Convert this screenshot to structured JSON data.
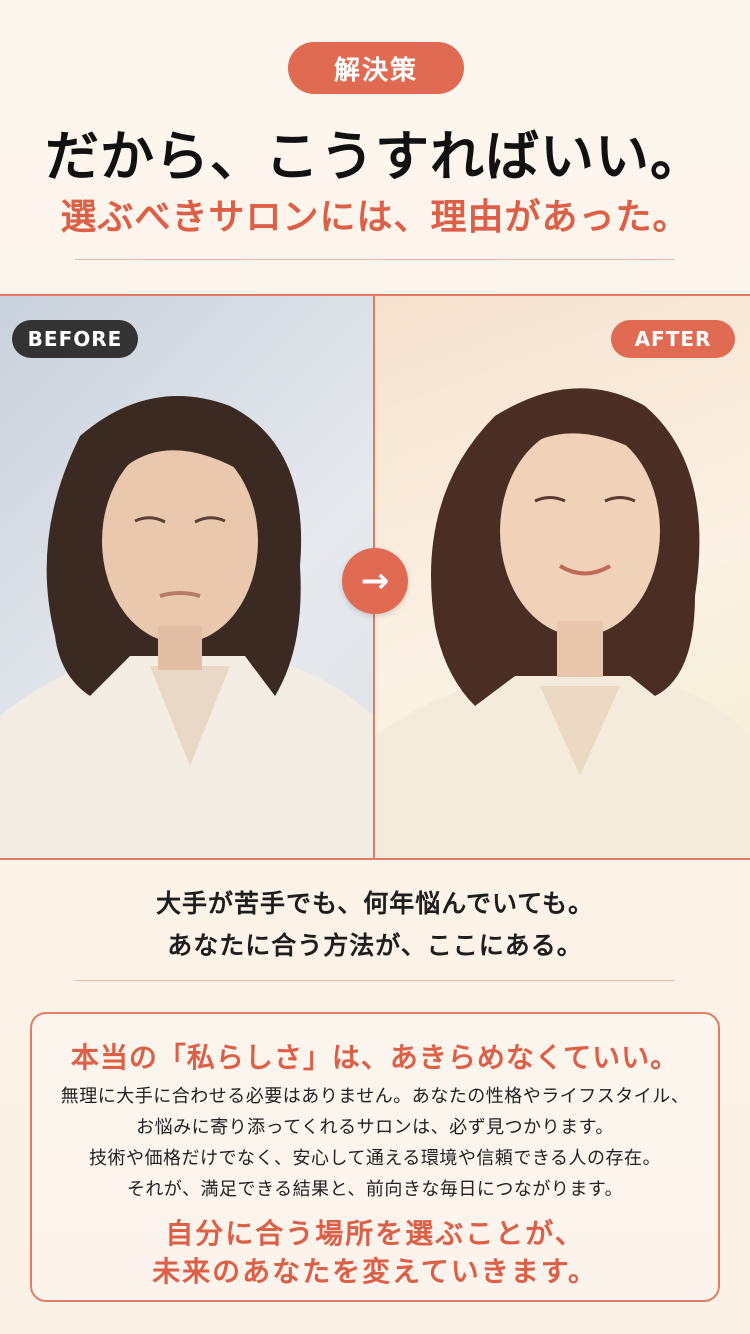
{
  "badge": "解決策",
  "headline": "だから、こうすればいい。",
  "subheadline": "選ぶべきサロンには、理由があった。",
  "comparison": {
    "before_label": "BEFORE",
    "after_label": "AFTER",
    "arrow_icon": "arrow-right-icon"
  },
  "caption": {
    "line1": "大手が苦手でも、何年悩んでいても。",
    "line2": "あなたに合う方法が、ここにある。"
  },
  "card": {
    "title": "本当の「私らしさ」は、あきらめなくていい。",
    "lines": [
      "無理に大手に合わせる必要はありません。あなたの性格やライフスタイル、",
      "お悩みに寄り添ってくれるサロンは、必ず見つかります。",
      "技術や価格だけでなく、安心して通える環境や信頼できる人の存在。",
      "それが、満足できる結果と、前向きな毎日につながります。"
    ],
    "closing1": "自分に合う場所を選ぶことが、",
    "closing2": "未来のあなたを変えていきます。"
  },
  "colors": {
    "accent": "#e06a52",
    "accent_text": "#dc5f47",
    "background": "#fdf6ee",
    "dark": "#333333"
  }
}
